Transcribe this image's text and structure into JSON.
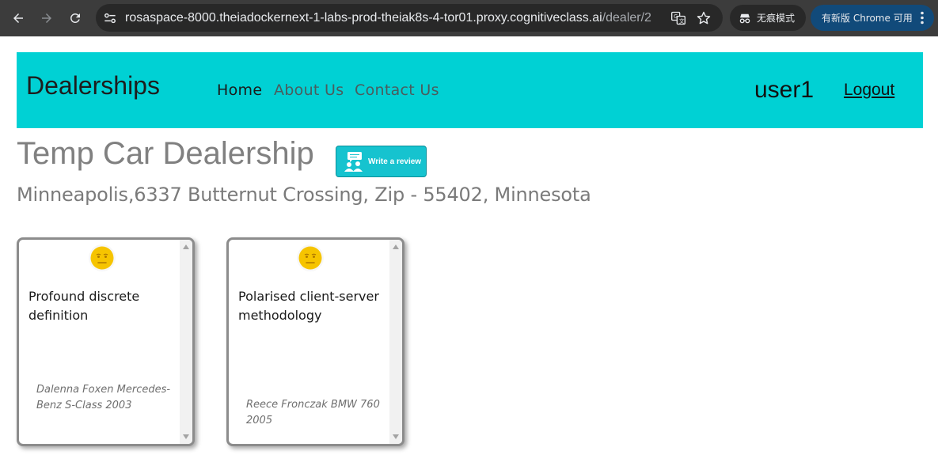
{
  "browser": {
    "url_host": "rosaspace-8000.theiadockernext-1-labs-prod-theiak8s-4-tor01.proxy.cognitiveclass.ai",
    "url_path": "/dealer/2",
    "incognito_label": "无痕模式",
    "update_label": "有新版 Chrome 可用",
    "icons": [
      "back-arrow-icon",
      "forward-arrow-icon",
      "reload-icon",
      "site-info-icon",
      "translate-icon",
      "star-icon",
      "incognito-icon",
      "kebab-menu-icon"
    ]
  },
  "navbar": {
    "brand": "Dealerships",
    "links": {
      "home": "Home",
      "about": "About Us",
      "contact": "Contact Us"
    },
    "username": "user1",
    "logout": "Logout",
    "background": "#00d1d4"
  },
  "dealer": {
    "name": "Temp Car Dealership",
    "address": "Minneapolis,6337 Butternut Crossing, Zip - 55402, Minnesota",
    "review_button_label": "Write a review"
  },
  "reviews": [
    {
      "sentiment_icon": "neutral-face-icon",
      "text": "Profound discrete definition",
      "reviewer_line": "Dalenna Foxen Mercedes-Benz S-Class 2003"
    },
    {
      "sentiment_icon": "neutral-face-icon",
      "text": "Polarised client-server methodology",
      "reviewer_line": "Reece Fronczak BMW 760 2005"
    }
  ]
}
